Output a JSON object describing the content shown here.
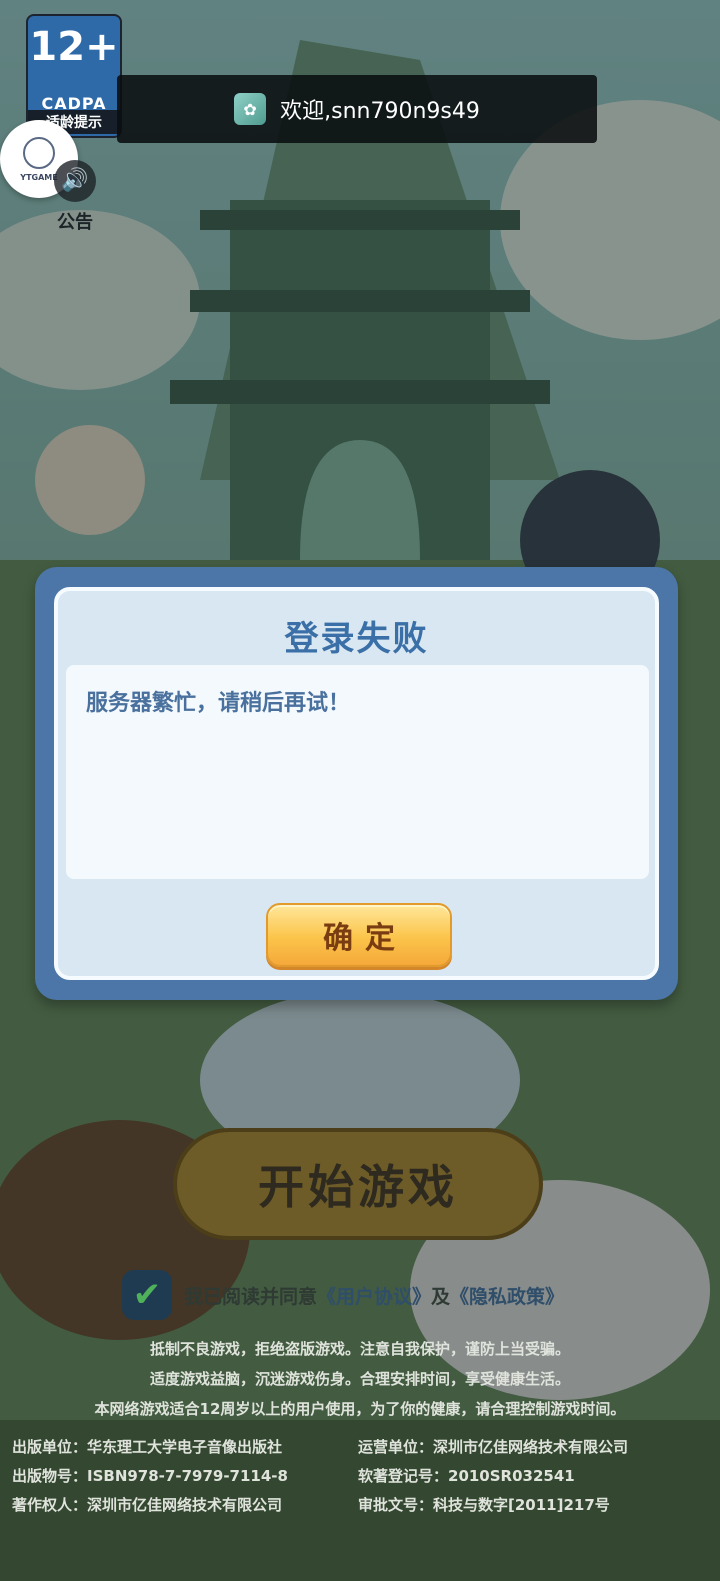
{
  "age_badge": {
    "rating": "12+",
    "org": "CADPA",
    "tip": "适龄提示"
  },
  "welcome_toast": {
    "icon": "game-app-icon",
    "message": "欢迎,snn790n9s49"
  },
  "ytgame_button": {
    "label": "YTGAME"
  },
  "notice_button": {
    "icon": "speaker-icon",
    "label": "公告"
  },
  "dialog": {
    "title": "登录失败",
    "message": "服务器繁忙，请稍后再试！",
    "confirm_label": "确定"
  },
  "start_button": {
    "label": "开始游戏"
  },
  "agreement": {
    "checked": true,
    "prefix": "我已阅读并同意",
    "user_agreement": "《用户协议》",
    "and": "及",
    "privacy_policy": "《隐私政策》"
  },
  "footer": {
    "health_lines": [
      "抵制不良游戏，拒绝盗版游戏。注意自我保护，谨防上当受骗。",
      "适度游戏益脑，沉迷游戏伤身。合理安排时间，享受健康生活。",
      "本网络游戏适合12周岁以上的用户使用，为了你的健康，请合理控制游戏时间。"
    ],
    "publisher": "出版单位：华东理工大学电子音像出版社",
    "operator": "运营单位：深圳市亿佳网络技术有限公司",
    "isbn": "出版物号：ISBN978-7-7979-7114-8",
    "software_reg": "软著登记号：2010SR032541",
    "copyright": "著作权人：深圳市亿佳网络技术有限公司",
    "approval": "审批文号：科技与数字[2011]217号"
  }
}
